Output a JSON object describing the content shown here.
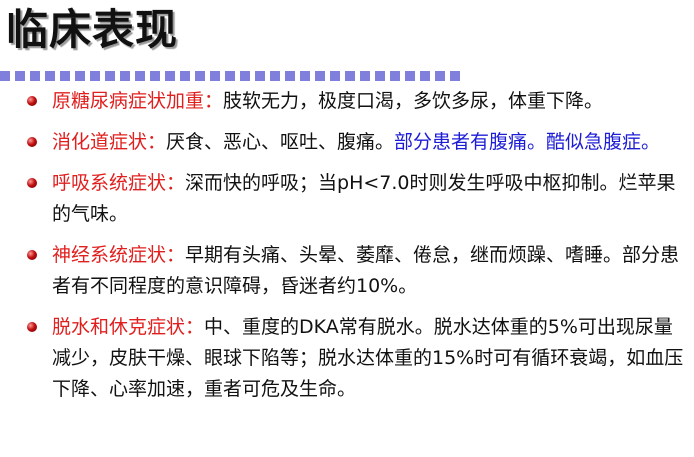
{
  "slide": {
    "title": "临床表现"
  },
  "colors": {
    "heading_label": "#e0201f",
    "highlight": "#1d1dd6",
    "divider": "#8080dc",
    "bullet": "#c01010"
  },
  "items": [
    {
      "label": "原糖尿病症状加重：",
      "text": "肢软无力，极度口渴，多饮多尿，体重下降。"
    },
    {
      "label": "消化道症状：",
      "text": "厌食、恶心、呕吐、腹痛。",
      "highlight": "部分患者有腹痛。酷似急腹症。"
    },
    {
      "label": "呼吸系统症状：",
      "text": "深而快的呼吸；当pH<7.0时则发生呼吸中枢抑制。烂苹果的气味。"
    },
    {
      "label": "神经系统症状：",
      "text": "早期有头痛、头晕、萎靡、倦怠，继而烦躁、嗜睡。部分患者有不同程度的意识障碍，昏迷者约10%。"
    },
    {
      "label": "脱水和休克症状：",
      "text": "中、重度的DKA常有脱水。脱水达体重的5%可出现尿量减少，皮肤干燥、眼球下陷等；脱水达体重的15%时可有循环衰竭，如血压下降、心率加速，重者可危及生命。"
    }
  ]
}
